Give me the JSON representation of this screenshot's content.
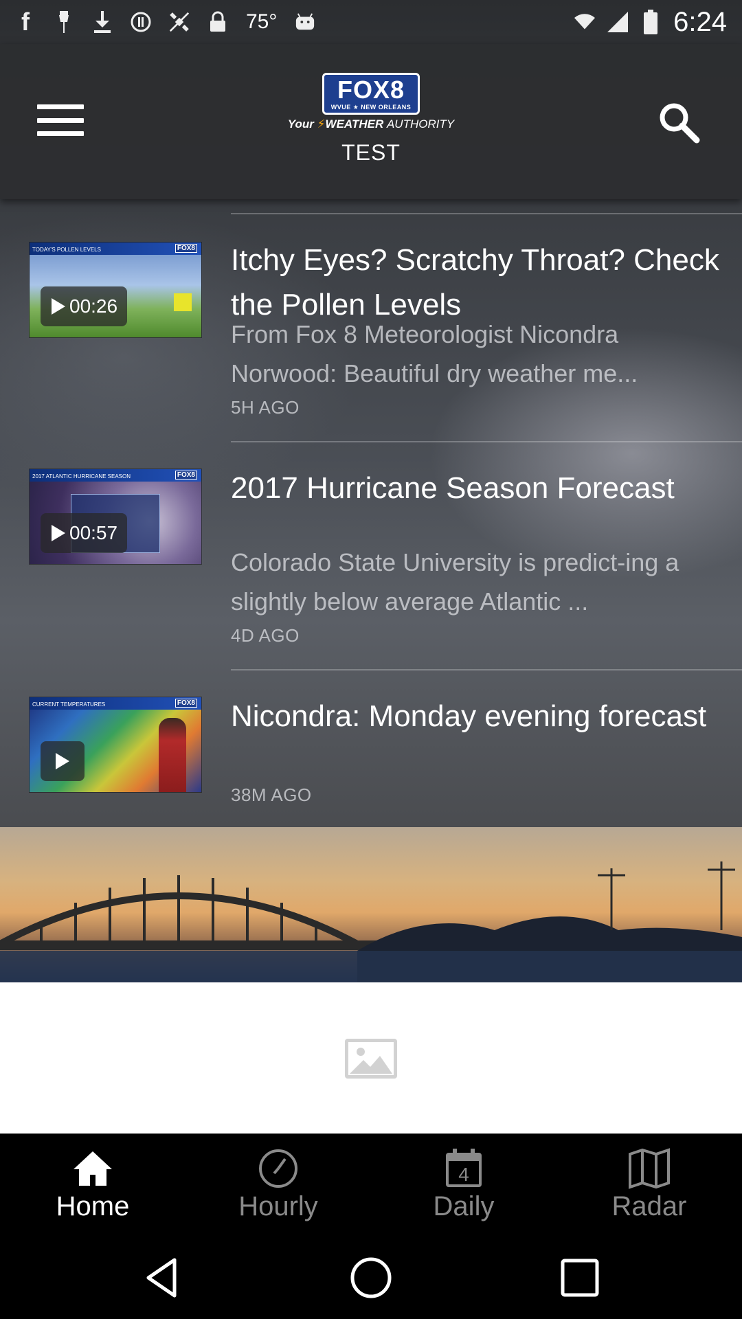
{
  "status_bar": {
    "temperature": "75°",
    "time": "6:24",
    "icons": [
      "facebook-icon",
      "pin-icon",
      "download-icon",
      "circle-icon",
      "satellite-off-icon",
      "fake-gps-icon",
      "lock-icon",
      "android-icon",
      "wifi-icon",
      "signal-icon",
      "battery-icon"
    ]
  },
  "header": {
    "logo_main": "FOX8",
    "logo_sub": "WVUE ★ NEW ORLEANS",
    "logo_tag_your": "Your",
    "logo_tag_weather": "WEATHER",
    "logo_tag_authority": "AUTHORITY",
    "subtitle": "TEST",
    "menu_icon": "hamburger-menu-icon",
    "search_icon": "search-icon"
  },
  "news": [
    {
      "duration": "00:26",
      "title": "Itchy Eyes? Scratchy Throat? Check the Pollen Levels",
      "description": "From Fox 8 Meteorologist Nicondra Norwood: Beautiful dry weather me...",
      "time_ago": "5H AGO",
      "thumb_heading": "TODAY'S POLLEN LEVELS"
    },
    {
      "duration": "00:57",
      "title": "2017 Hurricane Season Forecast",
      "description": "Colorado State University is predict-ing a slightly below average Atlantic ...",
      "time_ago": "4D AGO",
      "thumb_heading": "2017 ATLANTIC HURRICANE SEASON"
    },
    {
      "duration": "",
      "title": "Nicondra: Monday evening forecast",
      "description": "",
      "time_ago": "38M AGO",
      "thumb_heading": "CURRENT TEMPERATURES"
    }
  ],
  "bottom_nav": {
    "items": [
      {
        "label": "Home",
        "icon": "home-icon",
        "active": true
      },
      {
        "label": "Hourly",
        "icon": "clock-icon",
        "active": false
      },
      {
        "label": "Daily",
        "icon": "calendar-icon",
        "active": false,
        "badge": "4"
      },
      {
        "label": "Radar",
        "icon": "map-icon",
        "active": false
      }
    ]
  },
  "colors": {
    "accent_orange": "#f2a30f",
    "fox_blue": "#1e3f8f",
    "active_nav": "#ffffff",
    "inactive_nav": "#8a8a8a"
  }
}
